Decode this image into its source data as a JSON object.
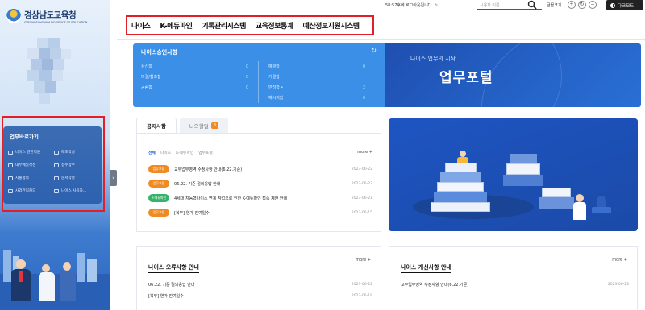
{
  "colors": {
    "accent_blue": "#3c8fe6",
    "portal_blue": "#1f57c3",
    "highlight_red": "#e01f26",
    "badge_orange": "#f08a22",
    "badge_green": "#35b36b"
  },
  "sidebar": {
    "logo_title": "경상남도교육청",
    "logo_sub": "GYEONGSANGNAM-DO OFFICE OF EDUCATION",
    "quick": {
      "title": "업무바로가기",
      "items": [
        {
          "label": "나이스 권한지원",
          "icon": "document-icon"
        },
        {
          "label": "메모작성",
          "icon": "memo-icon"
        },
        {
          "label": "내부메일작성",
          "icon": "mail-icon"
        },
        {
          "label": "접수함수",
          "icon": "inbox-icon"
        },
        {
          "label": "지출품의",
          "icon": "expense-icon"
        },
        {
          "label": "문서작성",
          "icon": "edit-icon"
        },
        {
          "label": "사업관리카드",
          "icon": "card-icon"
        },
        {
          "label": "나이스 사용자...",
          "icon": "user-icon"
        }
      ]
    },
    "collapse_icon": "‹"
  },
  "topbar": {
    "session": "58:57후에 로그아웃됩니다.",
    "session_icon": "refresh-icon",
    "session_icon_glyph": "↻",
    "search_placeholder": "시용자 이름",
    "search_icon": "search-icon",
    "fontsize_label": "글꼴크기",
    "zoom_in": "+",
    "reset": "↻",
    "zoom_out": "−",
    "dark_mode": "다크모드"
  },
  "nav": {
    "items": [
      "나이스",
      "K-에듀파인",
      "기록관리시스템",
      "교육정보통계",
      "예산정보지원시스템"
    ]
  },
  "approval": {
    "title": "나이스승인사항",
    "refresh_glyph": "↻",
    "left": [
      {
        "label": "상신함",
        "value": "0"
      },
      {
        "label": "미결/협조함",
        "value": "0"
      },
      {
        "label": "공람함",
        "value": "0"
      }
    ],
    "right": [
      {
        "label": "예결함",
        "value": "0"
      },
      {
        "label": "기결함",
        "value": ""
      },
      {
        "label": "반려함 •",
        "value": "2"
      },
      {
        "label": "예시지함",
        "value": "0"
      }
    ]
  },
  "portal": {
    "subtitle": "나이스 업무의 시작",
    "title": "업무포털"
  },
  "notice": {
    "tab_active": "공지사항",
    "tab_inactive": "나의할일",
    "tab_badge": "3",
    "categories": [
      "전체",
      "나이스",
      "K-에듀파인",
      "업무포털"
    ],
    "more": "more +",
    "items": [
      {
        "badge": "업무포털",
        "badge_color": "#f08a22",
        "text": "교무업무영역 수정사항 안내(6.22.기준)",
        "date": "2023-06-22"
      },
      {
        "badge": "업무포털",
        "badge_color": "#f08a22",
        "text": "06.22. 기준 절의응답 안내",
        "date": "2023-06-22"
      },
      {
        "badge": "K-에듀파인",
        "badge_color": "#35b36b",
        "text": "4세대 지능형나이스 연계 작업으로 인한 K-에듀파인 접속 제한 안내",
        "date": "2023-06-21"
      },
      {
        "badge": "업무포털",
        "badge_color": "#f08a22",
        "text": "[복무] 연가 잔여일수",
        "date": "2023-06-15"
      }
    ]
  },
  "error_panel": {
    "title": "나이스 오류사항 안내",
    "more": "more +",
    "items": [
      {
        "text": "06.22. 기준 절의응답 안내",
        "date": "2023-06-22"
      },
      {
        "text": "[복무] 연가 잔여일수",
        "date": "2023-06-19"
      }
    ]
  },
  "improve_panel": {
    "title": "나이스 개선사항 안내",
    "more": "more +",
    "items": [
      {
        "text": "교무업무영역 수정사항 안내(6.22.기준)",
        "date": "2023-06-23"
      }
    ]
  }
}
